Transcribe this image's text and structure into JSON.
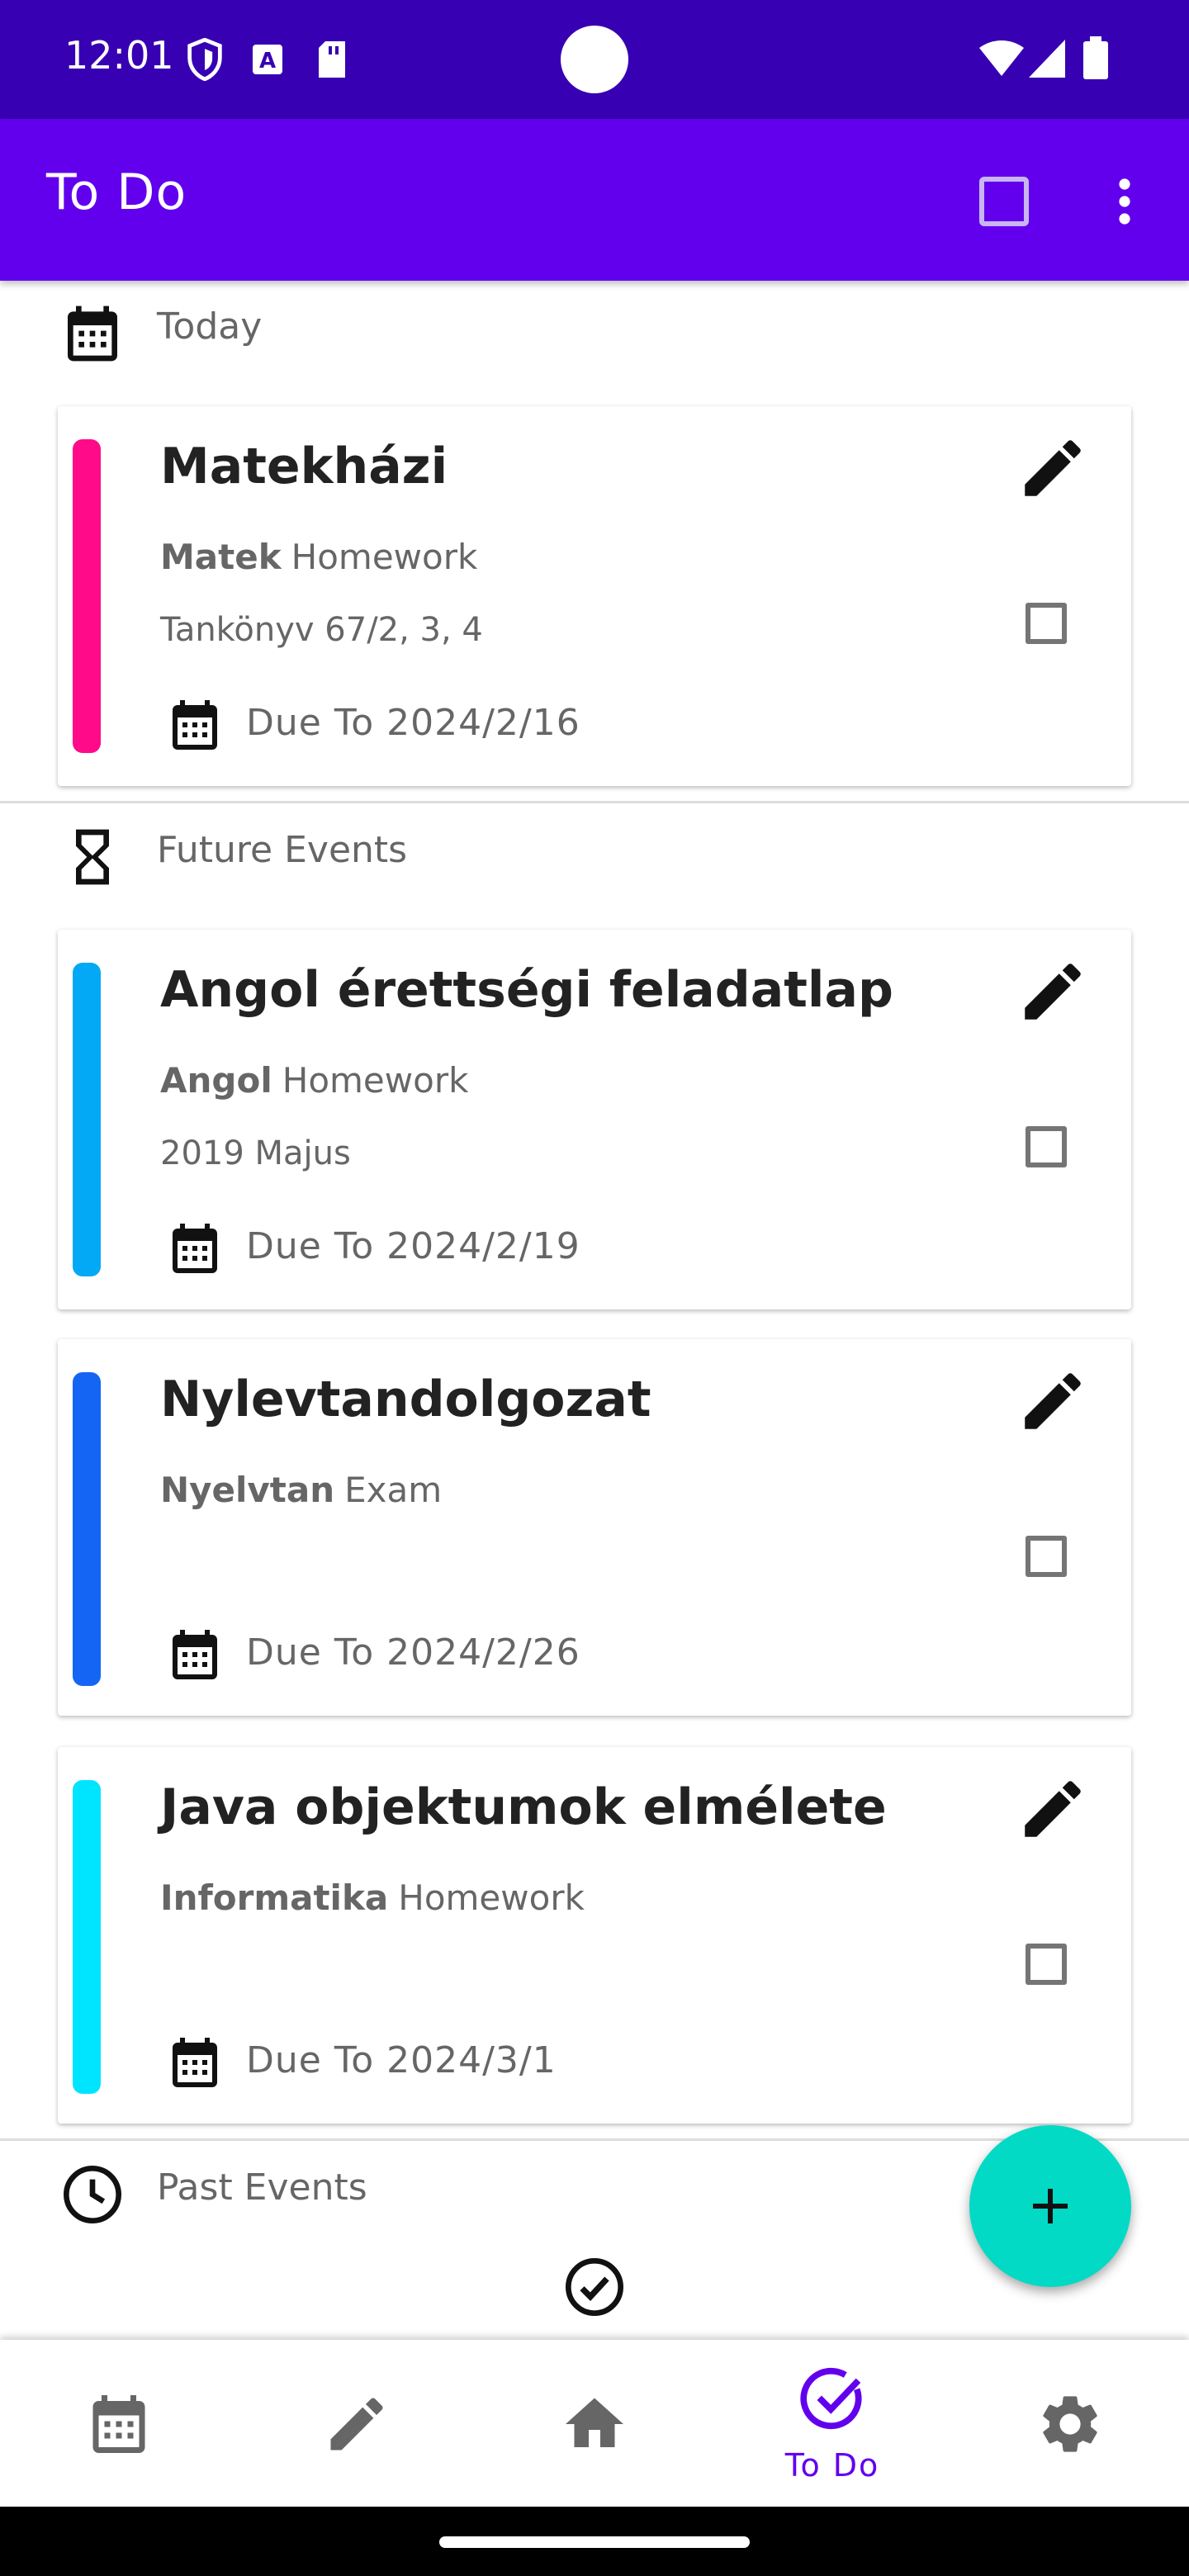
{
  "status_bar": {
    "time": "12:01"
  },
  "appbar": {
    "title": "To Do"
  },
  "sections": {
    "today": "Today",
    "future": "Future Events",
    "past": "Past Events"
  },
  "tasks": [
    {
      "title": "Matekházi",
      "subject": "Matek",
      "type": "Homework",
      "description": "Tankönyv 67/2, 3, 4",
      "due": "Due To  2024/2/16",
      "color": "#ff0a88"
    },
    {
      "title": "Angol érettségi feladatlap",
      "subject": "Angol",
      "type": "Homework",
      "description": "2019 Majus",
      "due": "Due To  2024/2/19",
      "color": "#03a9f4"
    },
    {
      "title": "Nylevtandolgozat",
      "subject": "Nyelvtan",
      "type": "Exam",
      "description": "",
      "due": "Due To  2024/2/26",
      "color": "#1565f5"
    },
    {
      "title": "Java objektumok elmélete",
      "subject": "Informatika",
      "type": "Homework",
      "description": "",
      "due": "Due To  2024/3/1",
      "color": "#00e5ff"
    }
  ],
  "bottom_nav": {
    "todo_label": "To Do"
  },
  "colors": {
    "primary": "#6200ee",
    "primary_dark": "#3700b3",
    "fab": "#03dac5"
  }
}
